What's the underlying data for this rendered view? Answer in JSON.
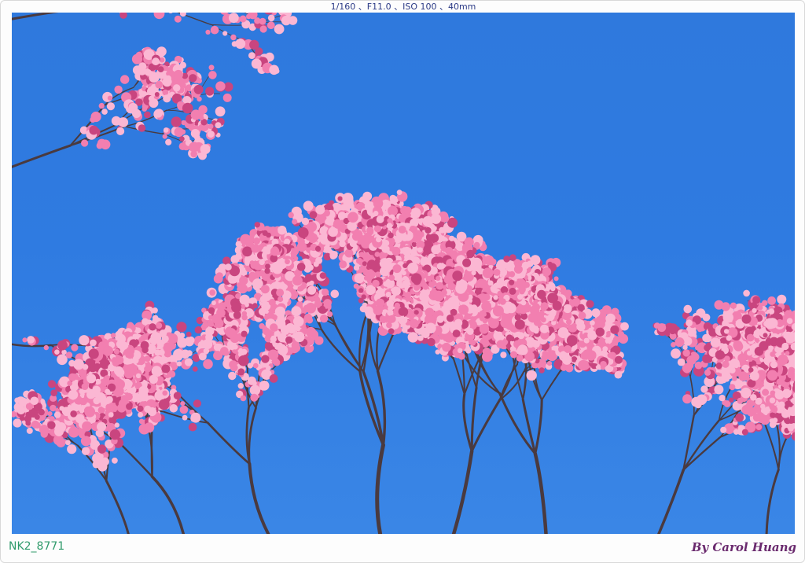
{
  "exif": "1/160 、F11.0 、ISO 100 、40mm",
  "file_id": "NK2_8771",
  "credit": "By Carol Huang",
  "colors": {
    "sky": "#2f7be1",
    "blossom": "#f27fb0",
    "blossom_light": "#fbb7d3",
    "blossom_dark": "#c9457f",
    "branch": "#4a3a3f",
    "file_id_text": "#2f9a6b",
    "credit_text": "#6a2a6e"
  },
  "icons": [
    "cherry-blossom-tree"
  ]
}
